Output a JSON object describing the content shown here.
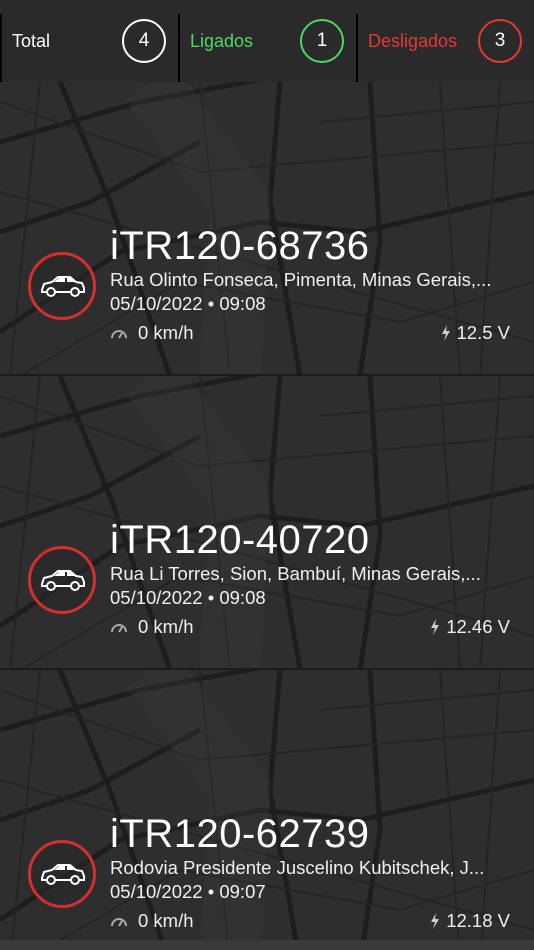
{
  "summary": {
    "total": {
      "label": "Total",
      "count": "4"
    },
    "on": {
      "label": "Ligados",
      "count": "1"
    },
    "off": {
      "label": "Desligados",
      "count": "3"
    }
  },
  "colors": {
    "on": "#4cd964",
    "off": "#e53935",
    "background": "#2e2e2e"
  },
  "vehicles": [
    {
      "id": "iTR120-68736",
      "address": "Rua Olinto Fonseca, Pimenta, Minas Gerais,...",
      "datetime": "05/10/2022 • 09:08",
      "speed": "0 km/h",
      "voltage": "12.5 V",
      "icon": "car-icon",
      "status": "off"
    },
    {
      "id": "iTR120-40720",
      "address": "Rua Li Torres, Sion, Bambuí, Minas Gerais,...",
      "datetime": "05/10/2022 • 09:08",
      "speed": "0 km/h",
      "voltage": "12.46 V",
      "icon": "car-icon",
      "status": "off"
    },
    {
      "id": "iTR120-62739",
      "address": "Rodovia Presidente Juscelino Kubitschek, J...",
      "datetime": "05/10/2022 • 09:07",
      "speed": "0 km/h",
      "voltage": "12.18 V",
      "icon": "car-icon",
      "status": "off"
    }
  ]
}
